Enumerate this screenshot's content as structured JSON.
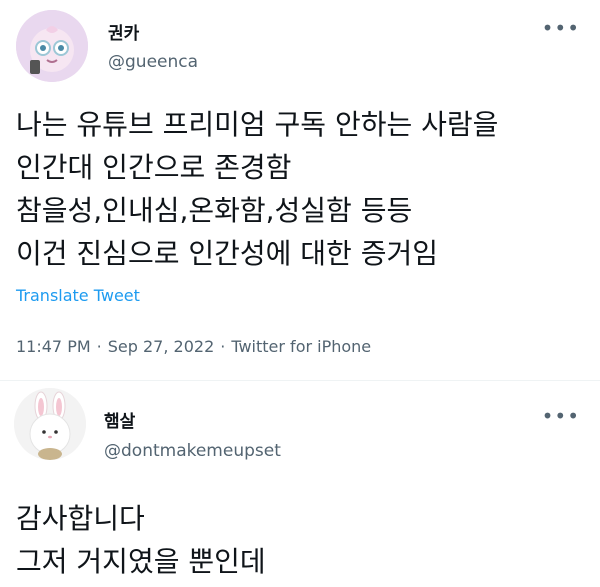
{
  "tweet1": {
    "display_name": "권카",
    "handle": "@gueenca",
    "more_icon": "more-horizontal-icon",
    "body_lines": [
      "나는 유튜브 프리미엄 구독 안하는 사람을",
      "인간대 인간으로 존경함",
      "참을성,인내심,온화함,성실함 등등",
      "이건 진심으로 인간성에 대한 증거임"
    ],
    "translate_label": "Translate Tweet",
    "time": "11:47 PM",
    "separator": "·",
    "date": "Sep 27, 2022",
    "source": "Twitter for iPhone"
  },
  "tweet2": {
    "display_name": "햄살",
    "handle": "@dontmakemeupset",
    "more_icon": "more-horizontal-icon",
    "body_lines": [
      "감사합니다",
      "그저 거지였을 뿐인데"
    ]
  },
  "colors": {
    "text": "#0f1419",
    "secondary": "#536471",
    "link": "#1d9bf0",
    "divider": "#eff3f4"
  }
}
